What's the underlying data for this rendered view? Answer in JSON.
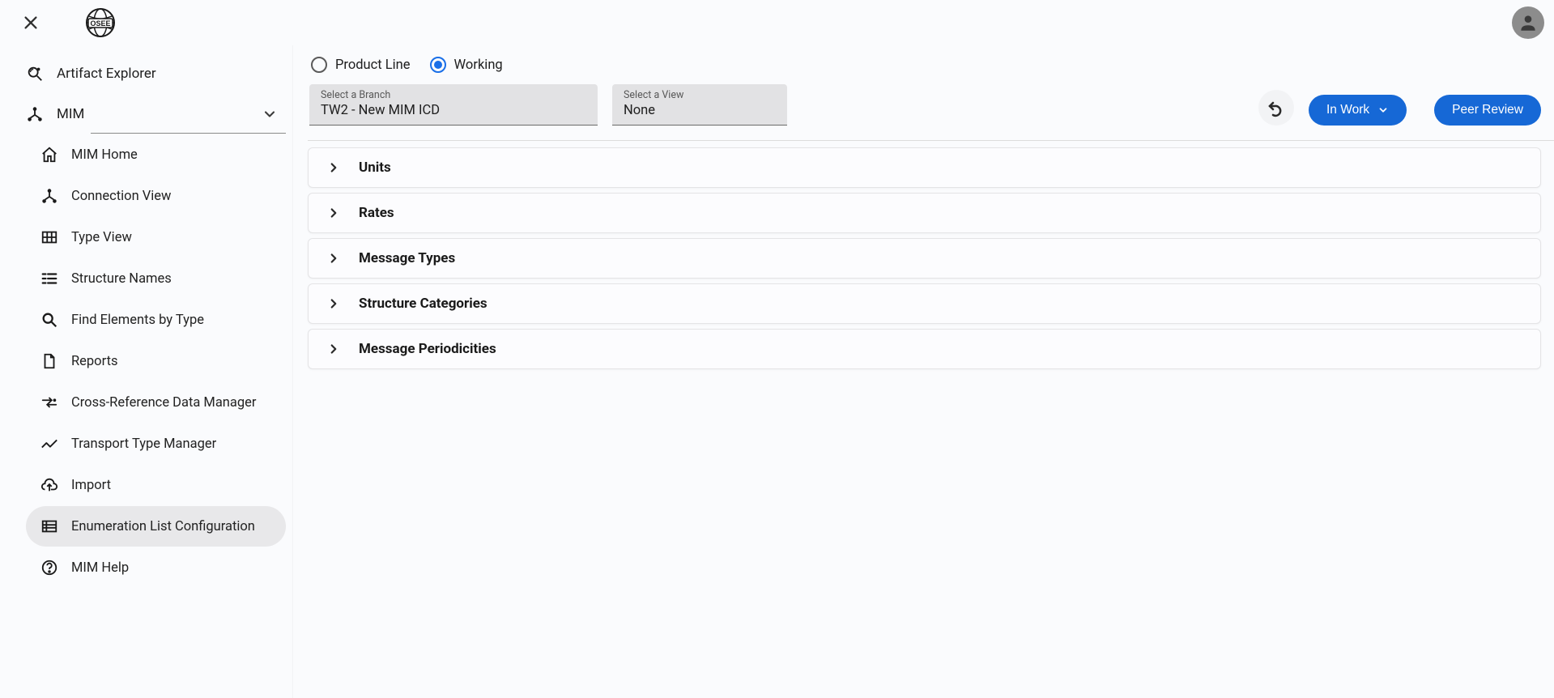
{
  "sidebar": {
    "artifact_explorer": "Artifact Explorer",
    "mim": "MIM",
    "items": [
      {
        "label": "MIM Home"
      },
      {
        "label": "Connection View"
      },
      {
        "label": "Type View"
      },
      {
        "label": "Structure Names"
      },
      {
        "label": "Find Elements by Type"
      },
      {
        "label": "Reports"
      },
      {
        "label": "Cross-Reference Data Manager"
      },
      {
        "label": "Transport Type Manager"
      },
      {
        "label": "Import"
      },
      {
        "label": "Enumeration List Configuration"
      },
      {
        "label": "MIM Help"
      }
    ]
  },
  "toolbar": {
    "radio_product_line": "Product Line",
    "radio_working": "Working",
    "branch_label": "Select a Branch",
    "branch_value": "TW2 - New MIM ICD",
    "view_label": "Select a View",
    "view_value": "None",
    "in_work": "In Work",
    "peer_review": "Peer Review"
  },
  "accordions": [
    {
      "title": "Units"
    },
    {
      "title": "Rates"
    },
    {
      "title": "Message Types"
    },
    {
      "title": "Structure Categories"
    },
    {
      "title": "Message Periodicities"
    }
  ]
}
